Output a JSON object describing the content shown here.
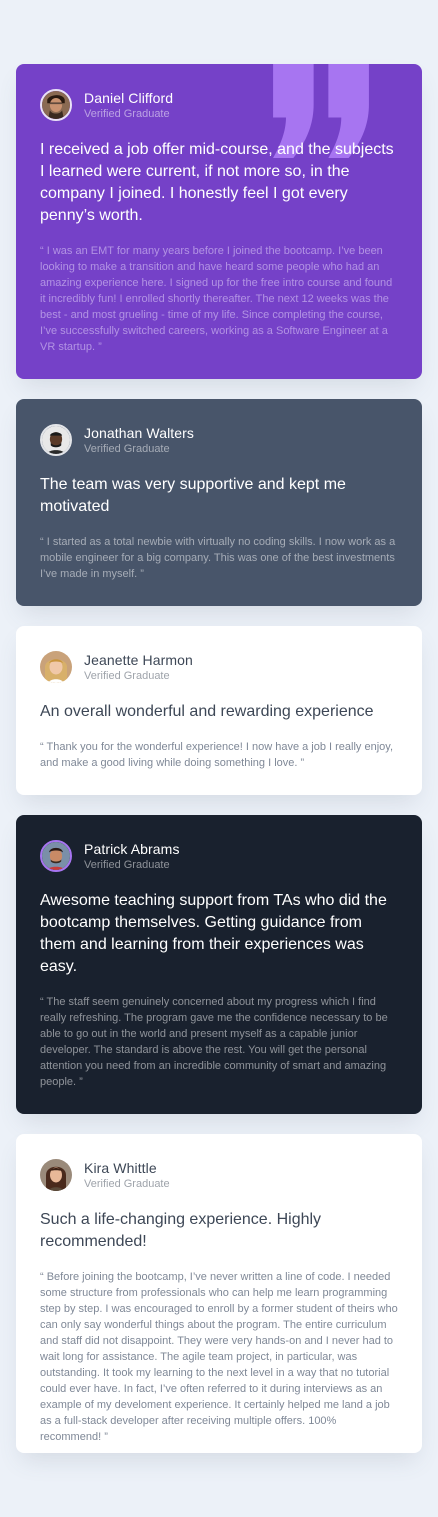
{
  "colors": {
    "background": "#ecf1f8",
    "purple": "#7541c8",
    "slate": "#48556a",
    "white": "#ffffff",
    "dark": "#19212e",
    "quote_mark": "#a775f1"
  },
  "testimonials": [
    {
      "name": "Daniel Clifford",
      "role": "Verified Graduate",
      "avatar_icon": "avatar-daniel-icon",
      "headline": "I received a job offer mid-course, and the subjects I learned were current, if not more so, in the company I joined. I honestly feel I got every penny’s worth.",
      "body": "“ I was an EMT for many years before I joined the bootcamp. I’ve been looking to make a transition and have heard some people who had an amazing experience here. I signed up for the free intro course and found it incredibly fun! I enrolled shortly thereafter. The next 12 weeks was the best - and most grueling - time of my life. Since completing the course, I’ve successfully switched careers, working as a Software Engineer at a VR startup. ”"
    },
    {
      "name": "Jonathan Walters",
      "role": "Verified Graduate",
      "avatar_icon": "avatar-jonathan-icon",
      "headline": "The team was very supportive and kept me motivated",
      "body": "“ I started as a total newbie with virtually no coding skills. I now work as a mobile engineer for a big company. This was one of the best investments I’ve made in myself. ”"
    },
    {
      "name": "Jeanette Harmon",
      "role": "Verified Graduate",
      "avatar_icon": "avatar-jeanette-icon",
      "headline": "An overall wonderful and rewarding experience",
      "body": "“ Thank you for the wonderful experience! I now have a job I really enjoy, and make a good living while doing something I love. ”"
    },
    {
      "name": "Patrick Abrams",
      "role": "Verified Graduate",
      "avatar_icon": "avatar-patrick-icon",
      "headline": "Awesome teaching support from TAs who did the bootcamp themselves. Getting guidance from them and learning from their experiences was easy.",
      "body": "“ The staff seem genuinely concerned about my progress which I find really refreshing. The program gave me the confidence necessary to be able to go out in the world and present myself as a capable junior developer. The standard is above the rest. You will get the personal attention you need from an incredible community of smart and amazing people. ”"
    },
    {
      "name": "Kira Whittle",
      "role": "Verified Graduate",
      "avatar_icon": "avatar-kira-icon",
      "headline": "Such a life-changing experience. Highly recommended!",
      "body": "“ Before joining the bootcamp, I’ve never written a line of code. I needed some structure from professionals who can help me learn programming step by step. I was encouraged to enroll by a former student of theirs who can only say wonderful things about the program. The entire curriculum and staff did not disappoint. They were very hands-on and I never had to wait long for assistance. The agile team project, in particular, was outstanding. It took my learning to the next level in a way that no tutorial could ever have. In fact, I’ve often referred to it during interviews as an example of my develoment experience. It certainly helped me land a job as a full-stack developer after receiving multiple offers. 100% recommend! ”"
    }
  ]
}
